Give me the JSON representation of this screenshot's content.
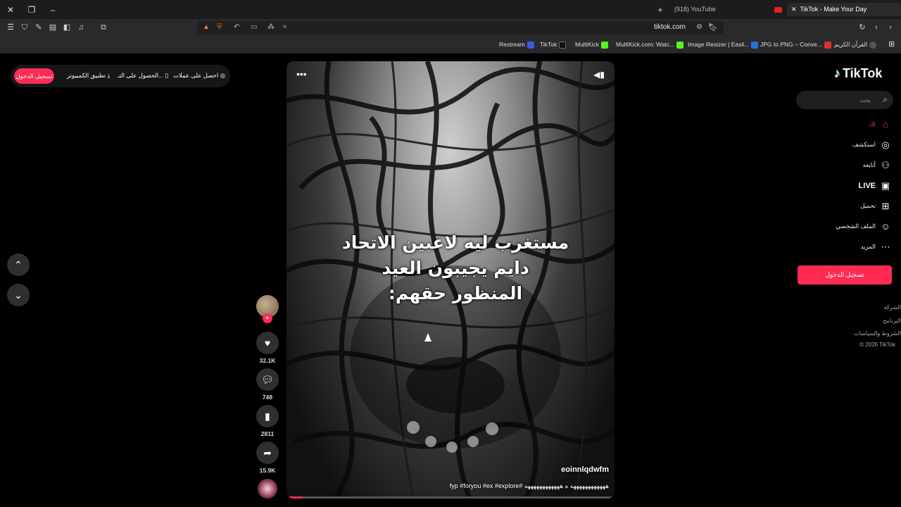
{
  "browser": {
    "tabs": [
      {
        "label": "(918) YouTube"
      },
      {
        "label": "TikTok - Make Your Day"
      }
    ],
    "url": "tiktok.com",
    "bookmarks": [
      {
        "label": "Restream",
        "color": "#3b5bdb"
      },
      {
        "label": "TikTok",
        "color": "#111111"
      },
      {
        "label": "MultiKick",
        "color": "#53fc18"
      },
      {
        "label": "MultiKick.com: Watc...",
        "color": "#53fc18"
      },
      {
        "label": "Image Resizer | Easil...",
        "color": "#2b6fd6"
      },
      {
        "label": "JPG to PNG – Conve...",
        "color": "#e03131"
      },
      {
        "label": "القرآن الكريم",
        "color": "#555555"
      }
    ]
  },
  "topbar": {
    "login": "تسجيل الدخول",
    "desktop_app": "تطبيق الكمبيوتر",
    "get_app": "الحصول على التـ...",
    "coins": "احصل على عملات"
  },
  "video": {
    "overlay_lines": [
      "مستغرب ليه لاعبين الاتحاد",
      "دايم يجيبون العيد",
      "المنظور حقهم:"
    ],
    "username": "eoinnlqdwfm",
    "caption": "ههههههههههههه ه ههههههههههههه #fyp #foryou #ex #explore",
    "progress": 0.05
  },
  "actions": {
    "likes": "32.1K",
    "comments": "748",
    "saves": "2811",
    "shares": "15.9K"
  },
  "sidebar": {
    "logo": "TikTok",
    "search_placeholder": "بحث",
    "items": [
      {
        "label": "لك",
        "icon": "home-icon"
      },
      {
        "label": "استكشف",
        "icon": "compass-icon"
      },
      {
        "label": "أتابعه",
        "icon": "user-plus-icon"
      },
      {
        "label": "LIVE",
        "icon": "live-tv-icon"
      },
      {
        "label": "تحميل",
        "icon": "upload-plus-icon"
      },
      {
        "label": "الملف الشخصي",
        "icon": "profile-icon"
      },
      {
        "label": "المزيد",
        "icon": "more-dots-icon"
      }
    ],
    "login": "تسجيل الدخول",
    "footer": [
      "الشركة",
      "البرنامج",
      "الشروط والسياسات",
      "© 2026 TikTok"
    ]
  },
  "colors": {
    "accent": "#fe2c55",
    "background": "#000000"
  }
}
